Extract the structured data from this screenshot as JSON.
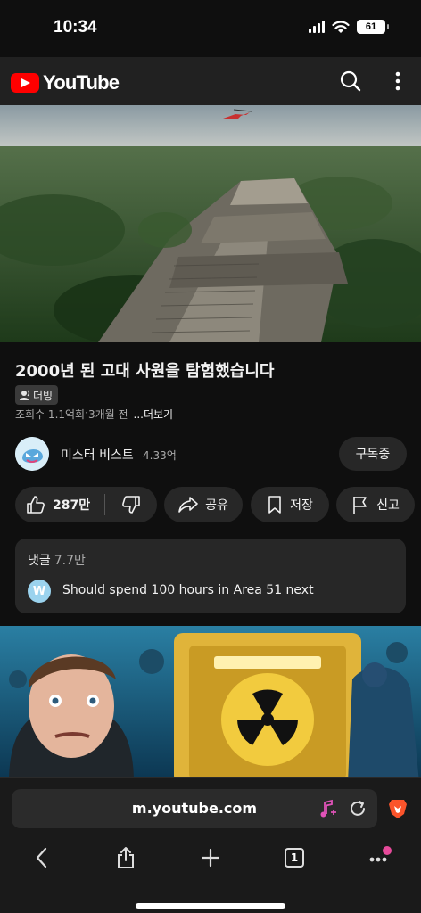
{
  "status_bar": {
    "time": "10:34",
    "battery": "61"
  },
  "header": {
    "logo_text": "YouTube"
  },
  "video": {
    "title": "2000년 된 고대 사원을 탐험했습니다",
    "dub_label": "더빙",
    "views": "조회수 1.1억회",
    "separator": " · ",
    "age": "3개월 전",
    "more": "...더보기"
  },
  "channel": {
    "name": "미스터 비스트",
    "subscribers": "4.33억",
    "subscribe_label": "구독중"
  },
  "actions": {
    "likes": "287만",
    "share": "공유",
    "save": "저장",
    "report": "신고"
  },
  "comments": {
    "label": "댓글",
    "count": "7.7만",
    "top_comment_avatar": "W",
    "top_comment": "Should spend 100 hours in Area 51 next"
  },
  "browser": {
    "url": "m.youtube.com",
    "tab_count": "1"
  },
  "colors": {
    "brand": "#ff0000",
    "background": "#0f0f0f",
    "header": "#212121",
    "pill": "#272727"
  },
  "icons": [
    "search-icon",
    "more-vert-icon",
    "thumbs-up-icon",
    "thumbs-down-icon",
    "share-icon",
    "bookmark-icon",
    "flag-icon",
    "music-icon",
    "reload-icon",
    "brave-icon",
    "back-icon",
    "share-sheet-icon",
    "plus-icon",
    "tabs-icon",
    "menu-dots-icon"
  ]
}
